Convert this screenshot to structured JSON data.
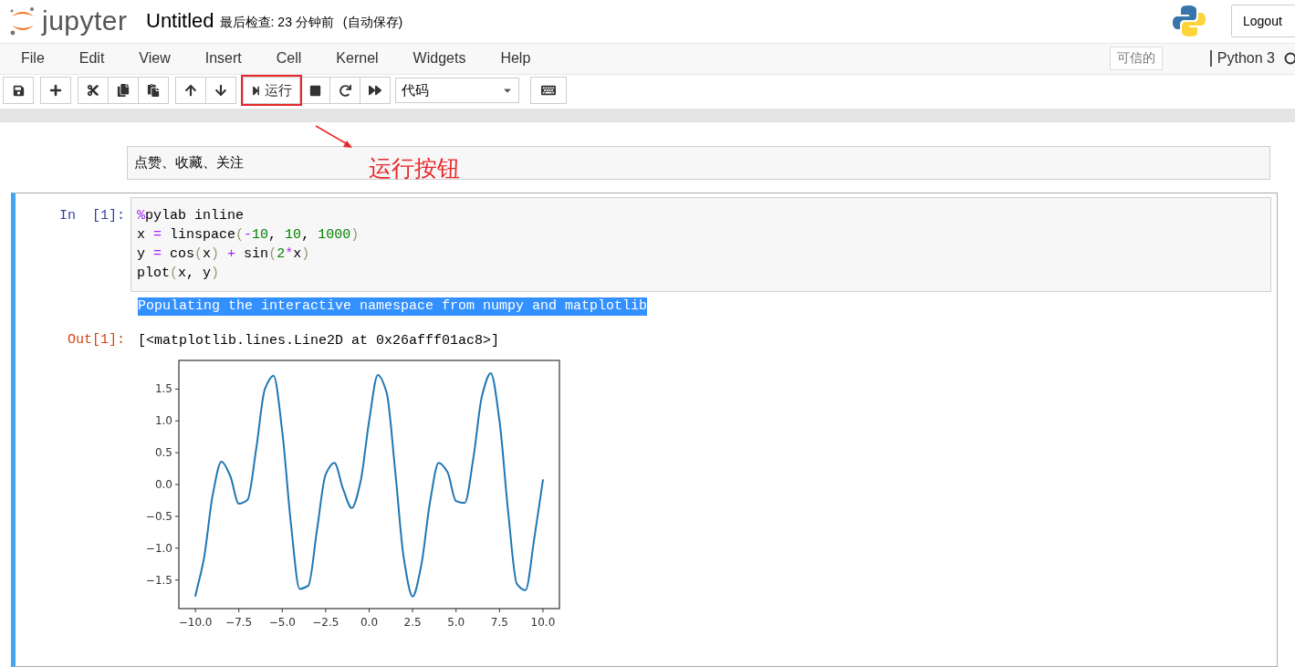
{
  "header": {
    "logo_text": "jupyter",
    "notebook_name": "Untitled",
    "checkpoint": "最后检查: 23 分钟前",
    "autosave": "(自动保存)",
    "logout": "Logout"
  },
  "menubar": {
    "items": [
      "File",
      "Edit",
      "View",
      "Insert",
      "Cell",
      "Kernel",
      "Widgets",
      "Help"
    ],
    "trusted": "可信的",
    "kernel": "Python 3"
  },
  "toolbar": {
    "groups": [
      [
        {
          "kind": "save"
        }
      ],
      [
        {
          "kind": "add"
        }
      ],
      [
        {
          "kind": "cut"
        },
        {
          "kind": "copy"
        },
        {
          "kind": "paste"
        }
      ],
      [
        {
          "kind": "up"
        },
        {
          "kind": "down"
        }
      ],
      [
        {
          "kind": "run",
          "label": "运行",
          "highlighted": true
        },
        {
          "kind": "stop"
        },
        {
          "kind": "restart"
        },
        {
          "kind": "runall"
        }
      ]
    ],
    "cell_type": "代码",
    "keyboard": {
      "kind": "keyboard"
    }
  },
  "annotation": {
    "label": "运行按钮"
  },
  "cells": [
    {
      "kind": "markdown",
      "selected": false,
      "text": "点赞、收藏、关注"
    },
    {
      "kind": "code",
      "selected": true,
      "prompt": "In  [1]:",
      "code": [
        [
          {
            "kind": "op",
            "text": "%"
          },
          {
            "kind": "plain",
            "text": "pylab inline"
          }
        ],
        [
          {
            "kind": "plain",
            "text": "x "
          },
          {
            "kind": "op",
            "text": "="
          },
          {
            "kind": "plain",
            "text": " linspace"
          },
          {
            "kind": "bracket",
            "text": "("
          },
          {
            "kind": "op",
            "text": "-"
          },
          {
            "kind": "num",
            "text": "10"
          },
          {
            "kind": "plain",
            "text": ", "
          },
          {
            "kind": "num",
            "text": "10"
          },
          {
            "kind": "plain",
            "text": ", "
          },
          {
            "kind": "num",
            "text": "1000"
          },
          {
            "kind": "bracket",
            "text": ")"
          }
        ],
        [
          {
            "kind": "plain",
            "text": "y "
          },
          {
            "kind": "op",
            "text": "="
          },
          {
            "kind": "plain",
            "text": " cos"
          },
          {
            "kind": "bracket",
            "text": "("
          },
          {
            "kind": "plain",
            "text": "x"
          },
          {
            "kind": "bracket",
            "text": ")"
          },
          {
            "kind": "op",
            "text": " +"
          },
          {
            "kind": "plain",
            "text": " sin"
          },
          {
            "kind": "bracket",
            "text": "("
          },
          {
            "kind": "num",
            "text": "2"
          },
          {
            "kind": "op",
            "text": "*"
          },
          {
            "kind": "plain",
            "text": "x"
          },
          {
            "kind": "bracket",
            "text": ")"
          }
        ],
        [
          {
            "kind": "plain",
            "text": "plot"
          },
          {
            "kind": "bracket",
            "text": "("
          },
          {
            "kind": "plain",
            "text": "x, y"
          },
          {
            "kind": "bracket",
            "text": ")"
          }
        ]
      ],
      "outputs": [
        {
          "kind": "stream",
          "text": "Populating the interactive namespace from numpy and matplotlib",
          "highlighted": true
        },
        {
          "kind": "result",
          "prompt": "Out[1]:",
          "text": "[<matplotlib.lines.Line2D at 0x26afff01ac8>]"
        },
        {
          "kind": "plot",
          "chart_data": {
            "type": "line",
            "xlim": [
              -10.95,
              10.95
            ],
            "ylim": [
              -1.95,
              1.95
            ],
            "xticks": [
              {
                "value": -10,
                "label": "−10.0"
              },
              {
                "value": -7.5,
                "label": "−7.5"
              },
              {
                "value": -5,
                "label": "−5.0"
              },
              {
                "value": -2.5,
                "label": "−2.5"
              },
              {
                "value": 0,
                "label": "0.0"
              },
              {
                "value": 2.5,
                "label": "2.5"
              },
              {
                "value": 5,
                "label": "5.0"
              },
              {
                "value": 7.5,
                "label": "7.5"
              },
              {
                "value": 10,
                "label": "10.0"
              }
            ],
            "yticks": [
              {
                "value": -1.5,
                "label": "−1.5"
              },
              {
                "value": -1,
                "label": "−1.0"
              },
              {
                "value": -0.5,
                "label": "−0.5"
              },
              {
                "value": 0,
                "label": "0.0"
              },
              {
                "value": 0.5,
                "label": "0.5"
              },
              {
                "value": 1,
                "label": "1.0"
              },
              {
                "value": 1.5,
                "label": "1.5"
              }
            ],
            "x": [
              -10,
              -9.5,
              -9,
              -8.5,
              -8,
              -7.5,
              -7,
              -6.5,
              -6,
              -5.5,
              -5,
              -4.5,
              -4,
              -3.5,
              -3,
              -2.5,
              -2,
              -1.5,
              -1,
              -0.5,
              0,
              0.5,
              1,
              1.5,
              2,
              2.5,
              3,
              3.5,
              4,
              4.5,
              5,
              5.5,
              6,
              6.5,
              7,
              7.5,
              8,
              8.5,
              9,
              9.5,
              10
            ],
            "series": [
              {
                "color": "#1f77b4",
                "values": [
                  -1.75,
                  -1.15,
                  -0.16,
                  0.36,
                  0.14,
                  -0.3,
                  -0.24,
                  0.56,
                  1.5,
                  1.71,
                  0.83,
                  -0.62,
                  -1.64,
                  -1.59,
                  -0.71,
                  0.16,
                  0.34,
                  -0.07,
                  -0.37,
                  0.04,
                  1.0,
                  1.72,
                  1.45,
                  0.21,
                  -1.17,
                  -1.76,
                  -1.27,
                  -0.28,
                  0.34,
                  0.2,
                  -0.26,
                  -0.29,
                  0.42,
                  1.4,
                  1.75,
                  1.0,
                  -0.43,
                  -1.56,
                  -1.66,
                  -0.85,
                  0.07
                ]
              }
            ]
          }
        }
      ]
    }
  ]
}
